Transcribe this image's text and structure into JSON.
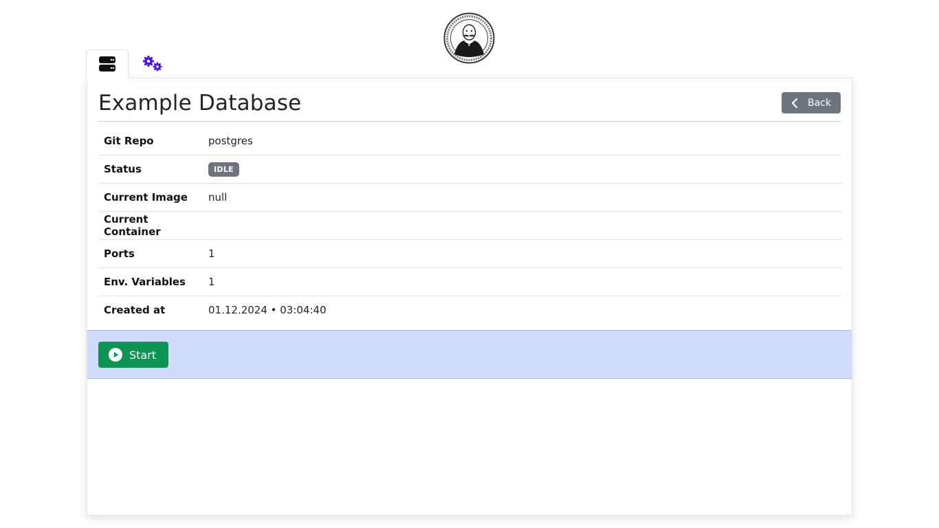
{
  "header": {
    "logo_icon": "gentleman-portrait-logo"
  },
  "tabs": [
    {
      "icon": "server-icon",
      "active": true
    },
    {
      "icon": "gears-icon",
      "active": false
    }
  ],
  "page": {
    "title": "Example Database",
    "back_label": "Back"
  },
  "details": {
    "rows": [
      {
        "label": "Git Repo",
        "value": "postgres"
      },
      {
        "label": "Status",
        "value": "IDLE"
      },
      {
        "label": "Current Image",
        "value": "null"
      },
      {
        "label": "Current Container",
        "value": ""
      },
      {
        "label": "Ports",
        "value": "1"
      },
      {
        "label": "Env. Variables",
        "value": "1"
      },
      {
        "label": "Created at",
        "value": "01.12.2024 • 03:04:40"
      }
    ]
  },
  "actions": {
    "start_label": "Start"
  },
  "colors": {
    "accent": "#4d16e0",
    "back_button": "#6c757d",
    "start_button": "#0d9453",
    "action_bar": "#d1dbfe",
    "status_badge": "#6c757d"
  }
}
